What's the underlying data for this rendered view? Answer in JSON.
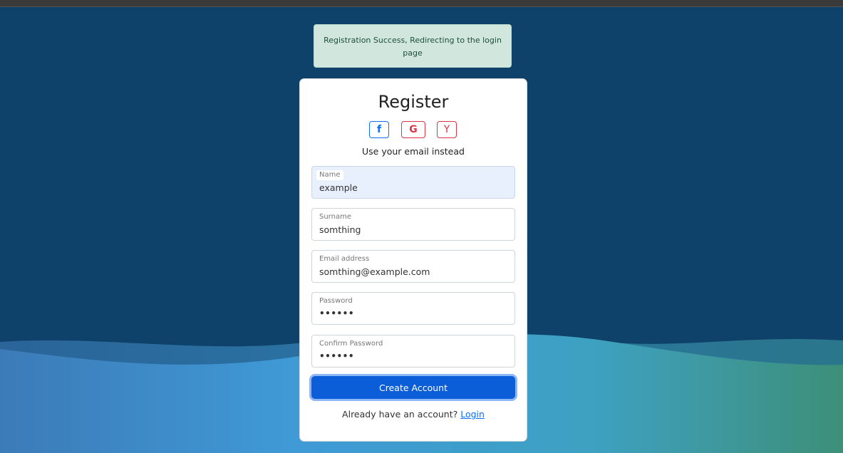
{
  "alert": {
    "message": "Registration Success, Redirecting to the login page"
  },
  "form": {
    "title": "Register",
    "social": [
      {
        "icon": "facebook-icon",
        "glyph": "f",
        "color": "#0d6efd"
      },
      {
        "icon": "google-icon",
        "glyph": "G",
        "color": "#dc3545"
      },
      {
        "icon": "yandex-icon",
        "glyph": "Y",
        "color": "#dc3545"
      }
    ],
    "subtitle": "Use your email instead",
    "fields": [
      {
        "label": "Name",
        "value": "example"
      },
      {
        "label": "Surname",
        "value": "somthing"
      },
      {
        "label": "Email address",
        "value": "somthing@example.com"
      },
      {
        "label": "Password",
        "value": "••••••"
      },
      {
        "label": "Confirm Password",
        "value": "••••••"
      }
    ],
    "submit_label": "Create Account",
    "footer_text": "Already have an account?",
    "login_link": "Login"
  },
  "colors": {
    "background": "#0f426b",
    "primary": "#0b5ed7",
    "alert_bg": "#d1e7dd"
  }
}
